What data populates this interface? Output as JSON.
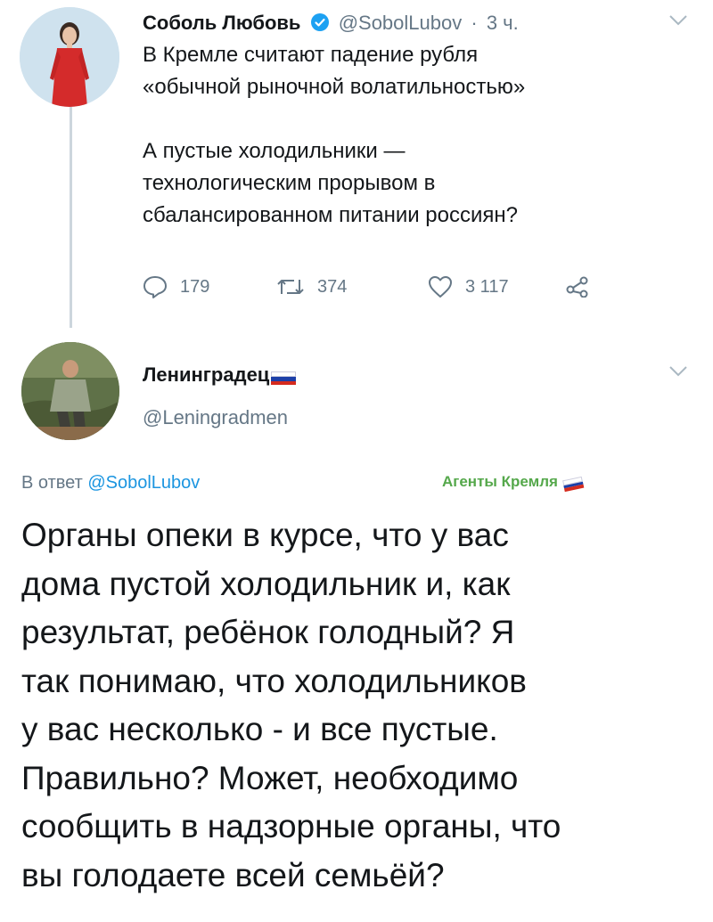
{
  "tweet1": {
    "author_name": "Соболь Любовь",
    "handle": "@SobolLubov",
    "separator": "·",
    "time": "3 ч.",
    "text_lines": [
      "В Кремле считают падение рубля",
      "«обычной рыночной волатильностью»",
      "А пустые холодильники —",
      "технологическим прорывом в",
      "сбалансированном питании россиян?"
    ],
    "stats": {
      "replies": "179",
      "retweets": "374",
      "likes": "3 117"
    }
  },
  "tweet2": {
    "author_name": "Ленинградец",
    "handle": "@Leningradmen",
    "reply_prefix": "В ответ",
    "reply_handle": "@SobolLubov",
    "badge": "Агенты Кремля",
    "text_lines": [
      "Органы опеки в курсе, что у вас",
      "дома пустой холодильник и, как",
      "результат, ребёнок голодный? Я",
      "так понимаю, что холодильников",
      "у вас несколько - и все пустые.",
      "Правильно? Может, необходимо",
      "сообщить в надзорные органы, что",
      "вы голодаете всей семьёй?"
    ]
  },
  "colors": {
    "text": "#14171a",
    "muted": "#657786",
    "link": "#1b95e0",
    "verified": "#1da1f2",
    "badge": "#55a84b",
    "flag_white": "#ffffff",
    "flag_blue": "#1c3fa8",
    "flag_red": "#d52b1e"
  },
  "icons": {
    "verified": "verified-badge-icon",
    "more": "chevron-down-icon",
    "reply": "comment-bubble-icon",
    "retweet": "retweet-icon",
    "like": "heart-icon",
    "share": "share-icon",
    "flag": "russia-flag-icon"
  }
}
